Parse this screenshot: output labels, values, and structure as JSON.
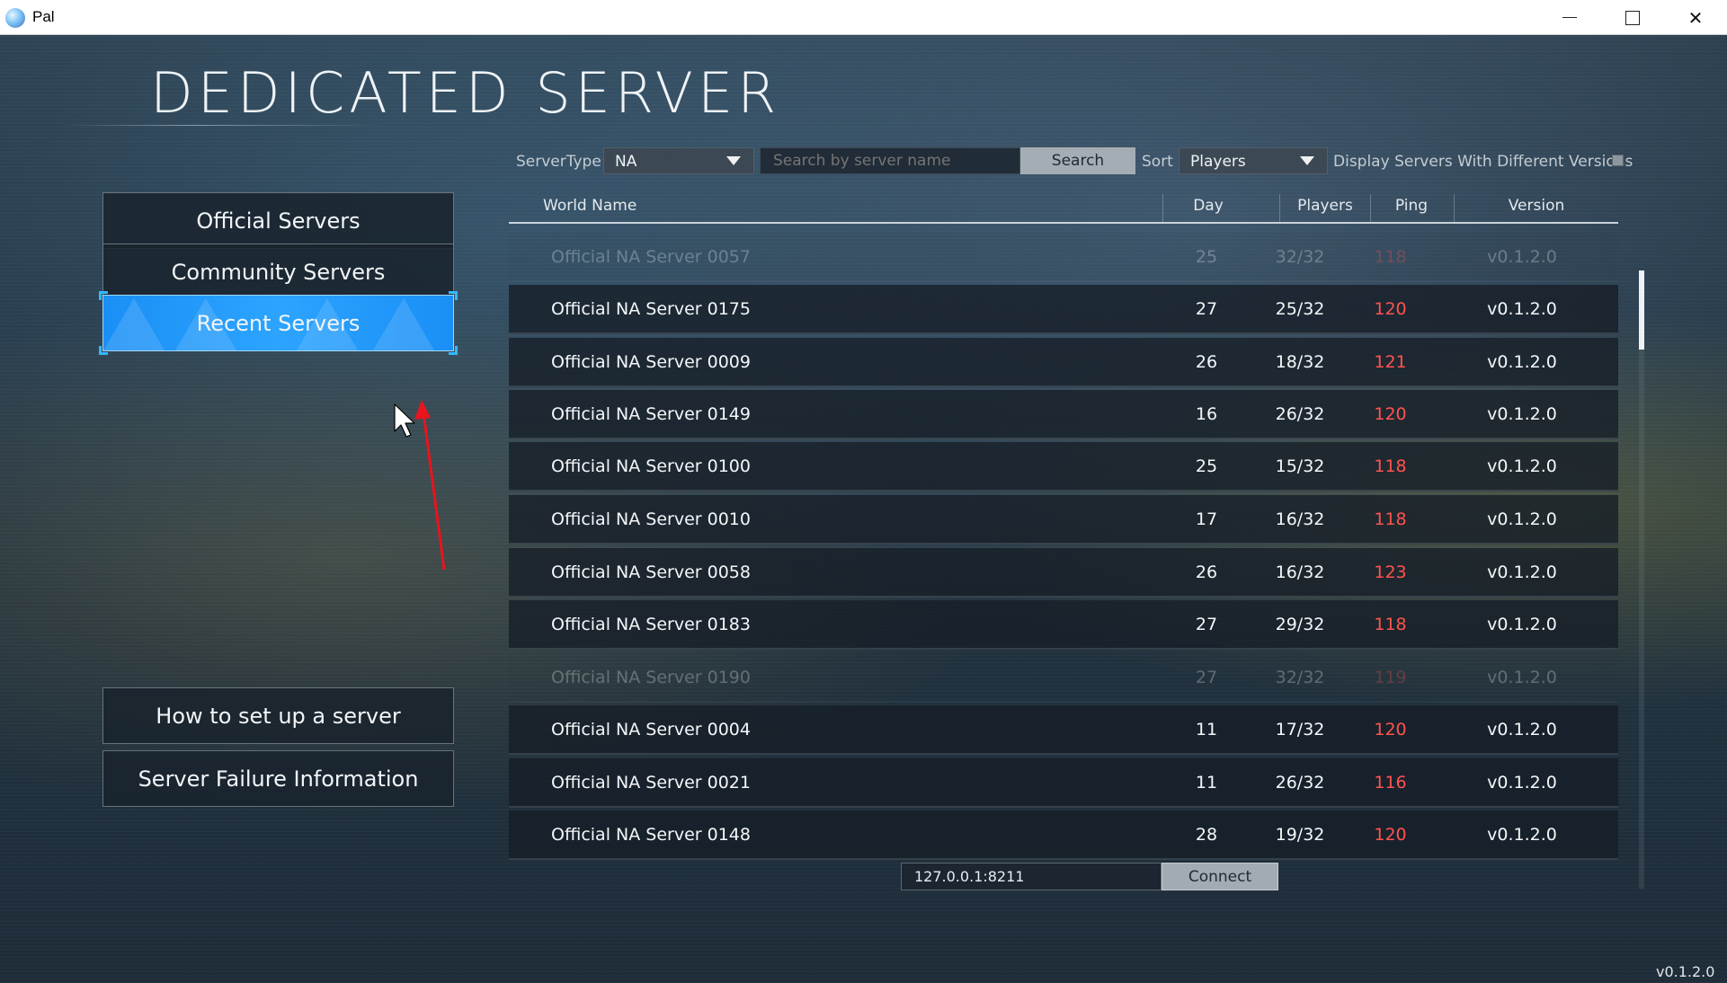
{
  "window": {
    "title": "Pal",
    "minimize": "minimize",
    "maximize": "maximize",
    "close": "✕"
  },
  "page": {
    "title": "DEDICATED SERVER"
  },
  "menu": {
    "official": "Official Servers",
    "community": "Community Servers",
    "recent": "Recent Servers",
    "howto": "How to set up a server",
    "failure": "Server Failure Information",
    "active": "recent"
  },
  "filters": {
    "server_type_label": "ServerType",
    "server_type_value": "NA",
    "search_placeholder": "Search by server name",
    "search_button": "Search",
    "sort_label": "Sort",
    "sort_value": "Players",
    "different_versions_label": "Display Servers With Different Versions",
    "different_versions_checked": false
  },
  "table": {
    "columns": [
      "World Name",
      "Day",
      "Players",
      "Ping",
      "Version"
    ],
    "rows": [
      {
        "name": "Official NA Server 0057",
        "day": "25",
        "players": "32/32",
        "ping": "118",
        "version": "v0.1.2.0",
        "dimmed": true
      },
      {
        "name": "Official NA Server 0175",
        "day": "27",
        "players": "25/32",
        "ping": "120",
        "version": "v0.1.2.0",
        "dimmed": false
      },
      {
        "name": "Official NA Server 0009",
        "day": "26",
        "players": "18/32",
        "ping": "121",
        "version": "v0.1.2.0",
        "dimmed": false
      },
      {
        "name": "Official NA Server 0149",
        "day": "16",
        "players": "26/32",
        "ping": "120",
        "version": "v0.1.2.0",
        "dimmed": false
      },
      {
        "name": "Official NA Server 0100",
        "day": "25",
        "players": "15/32",
        "ping": "118",
        "version": "v0.1.2.0",
        "dimmed": false
      },
      {
        "name": "Official NA Server 0010",
        "day": "17",
        "players": "16/32",
        "ping": "118",
        "version": "v0.1.2.0",
        "dimmed": false
      },
      {
        "name": "Official NA Server 0058",
        "day": "26",
        "players": "16/32",
        "ping": "123",
        "version": "v0.1.2.0",
        "dimmed": false
      },
      {
        "name": "Official NA Server 0183",
        "day": "27",
        "players": "29/32",
        "ping": "118",
        "version": "v0.1.2.0",
        "dimmed": false
      },
      {
        "name": "Official NA Server 0190",
        "day": "27",
        "players": "32/32",
        "ping": "119",
        "version": "v0.1.2.0",
        "dimmed": true
      },
      {
        "name": "Official NA Server 0004",
        "day": "11",
        "players": "17/32",
        "ping": "120",
        "version": "v0.1.2.0",
        "dimmed": false
      },
      {
        "name": "Official NA Server 0021",
        "day": "11",
        "players": "26/32",
        "ping": "116",
        "version": "v0.1.2.0",
        "dimmed": false
      },
      {
        "name": "Official NA Server 0148",
        "day": "28",
        "players": "19/32",
        "ping": "120",
        "version": "v0.1.2.0",
        "dimmed": false
      }
    ],
    "scroll_position": 0.0
  },
  "connect": {
    "address": "127.0.0.1:8211",
    "button": "Connect"
  },
  "version": "v0.1.2.0",
  "colors": {
    "accent": "#1a8ff5",
    "ping": "#ff5350"
  }
}
